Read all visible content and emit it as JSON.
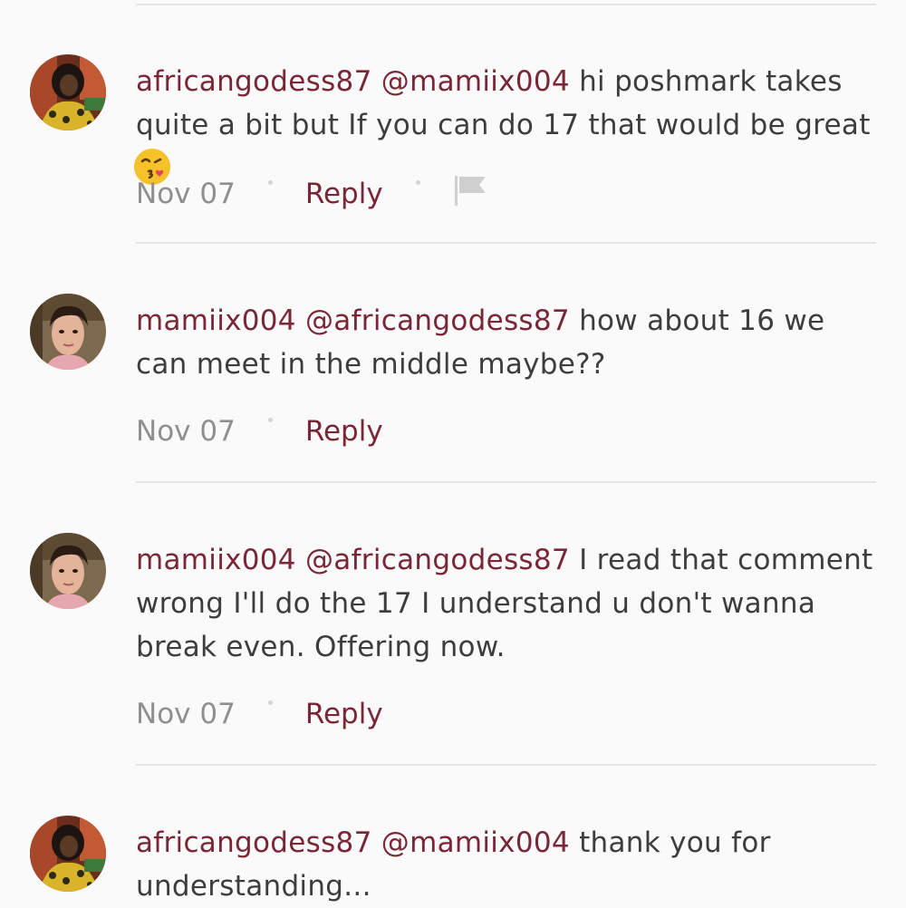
{
  "comments": [
    {
      "user": "africangodess87",
      "mention": "@mamiix004",
      "body": "hi poshmark takes quite a bit but If you can do 17 that would be great",
      "emoji": "kissing-face-emoji",
      "date": "Nov 07",
      "reply_label": "Reply",
      "has_flag": true
    },
    {
      "user": "mamiix004",
      "mention": "@africangodess87",
      "body": "how about 16 we can meet in the middle maybe??",
      "date": "Nov 07",
      "reply_label": "Reply"
    },
    {
      "user": "mamiix004",
      "mention": "@africangodess87",
      "body": "I read that comment wrong I'll do the 17 I understand u don't wanna break even. Offering now.",
      "date": "Nov 07",
      "reply_label": "Reply"
    },
    {
      "user": "africangodess87",
      "mention": "@mamiix004",
      "body": "thank you for understanding...",
      "date": "",
      "reply_label": ""
    }
  ],
  "colors": {
    "username": "#7a2636",
    "body_text": "#3d3d3d",
    "date": "#8f8f8f",
    "divider": "#e4e4e4",
    "background": "#fafafa"
  }
}
